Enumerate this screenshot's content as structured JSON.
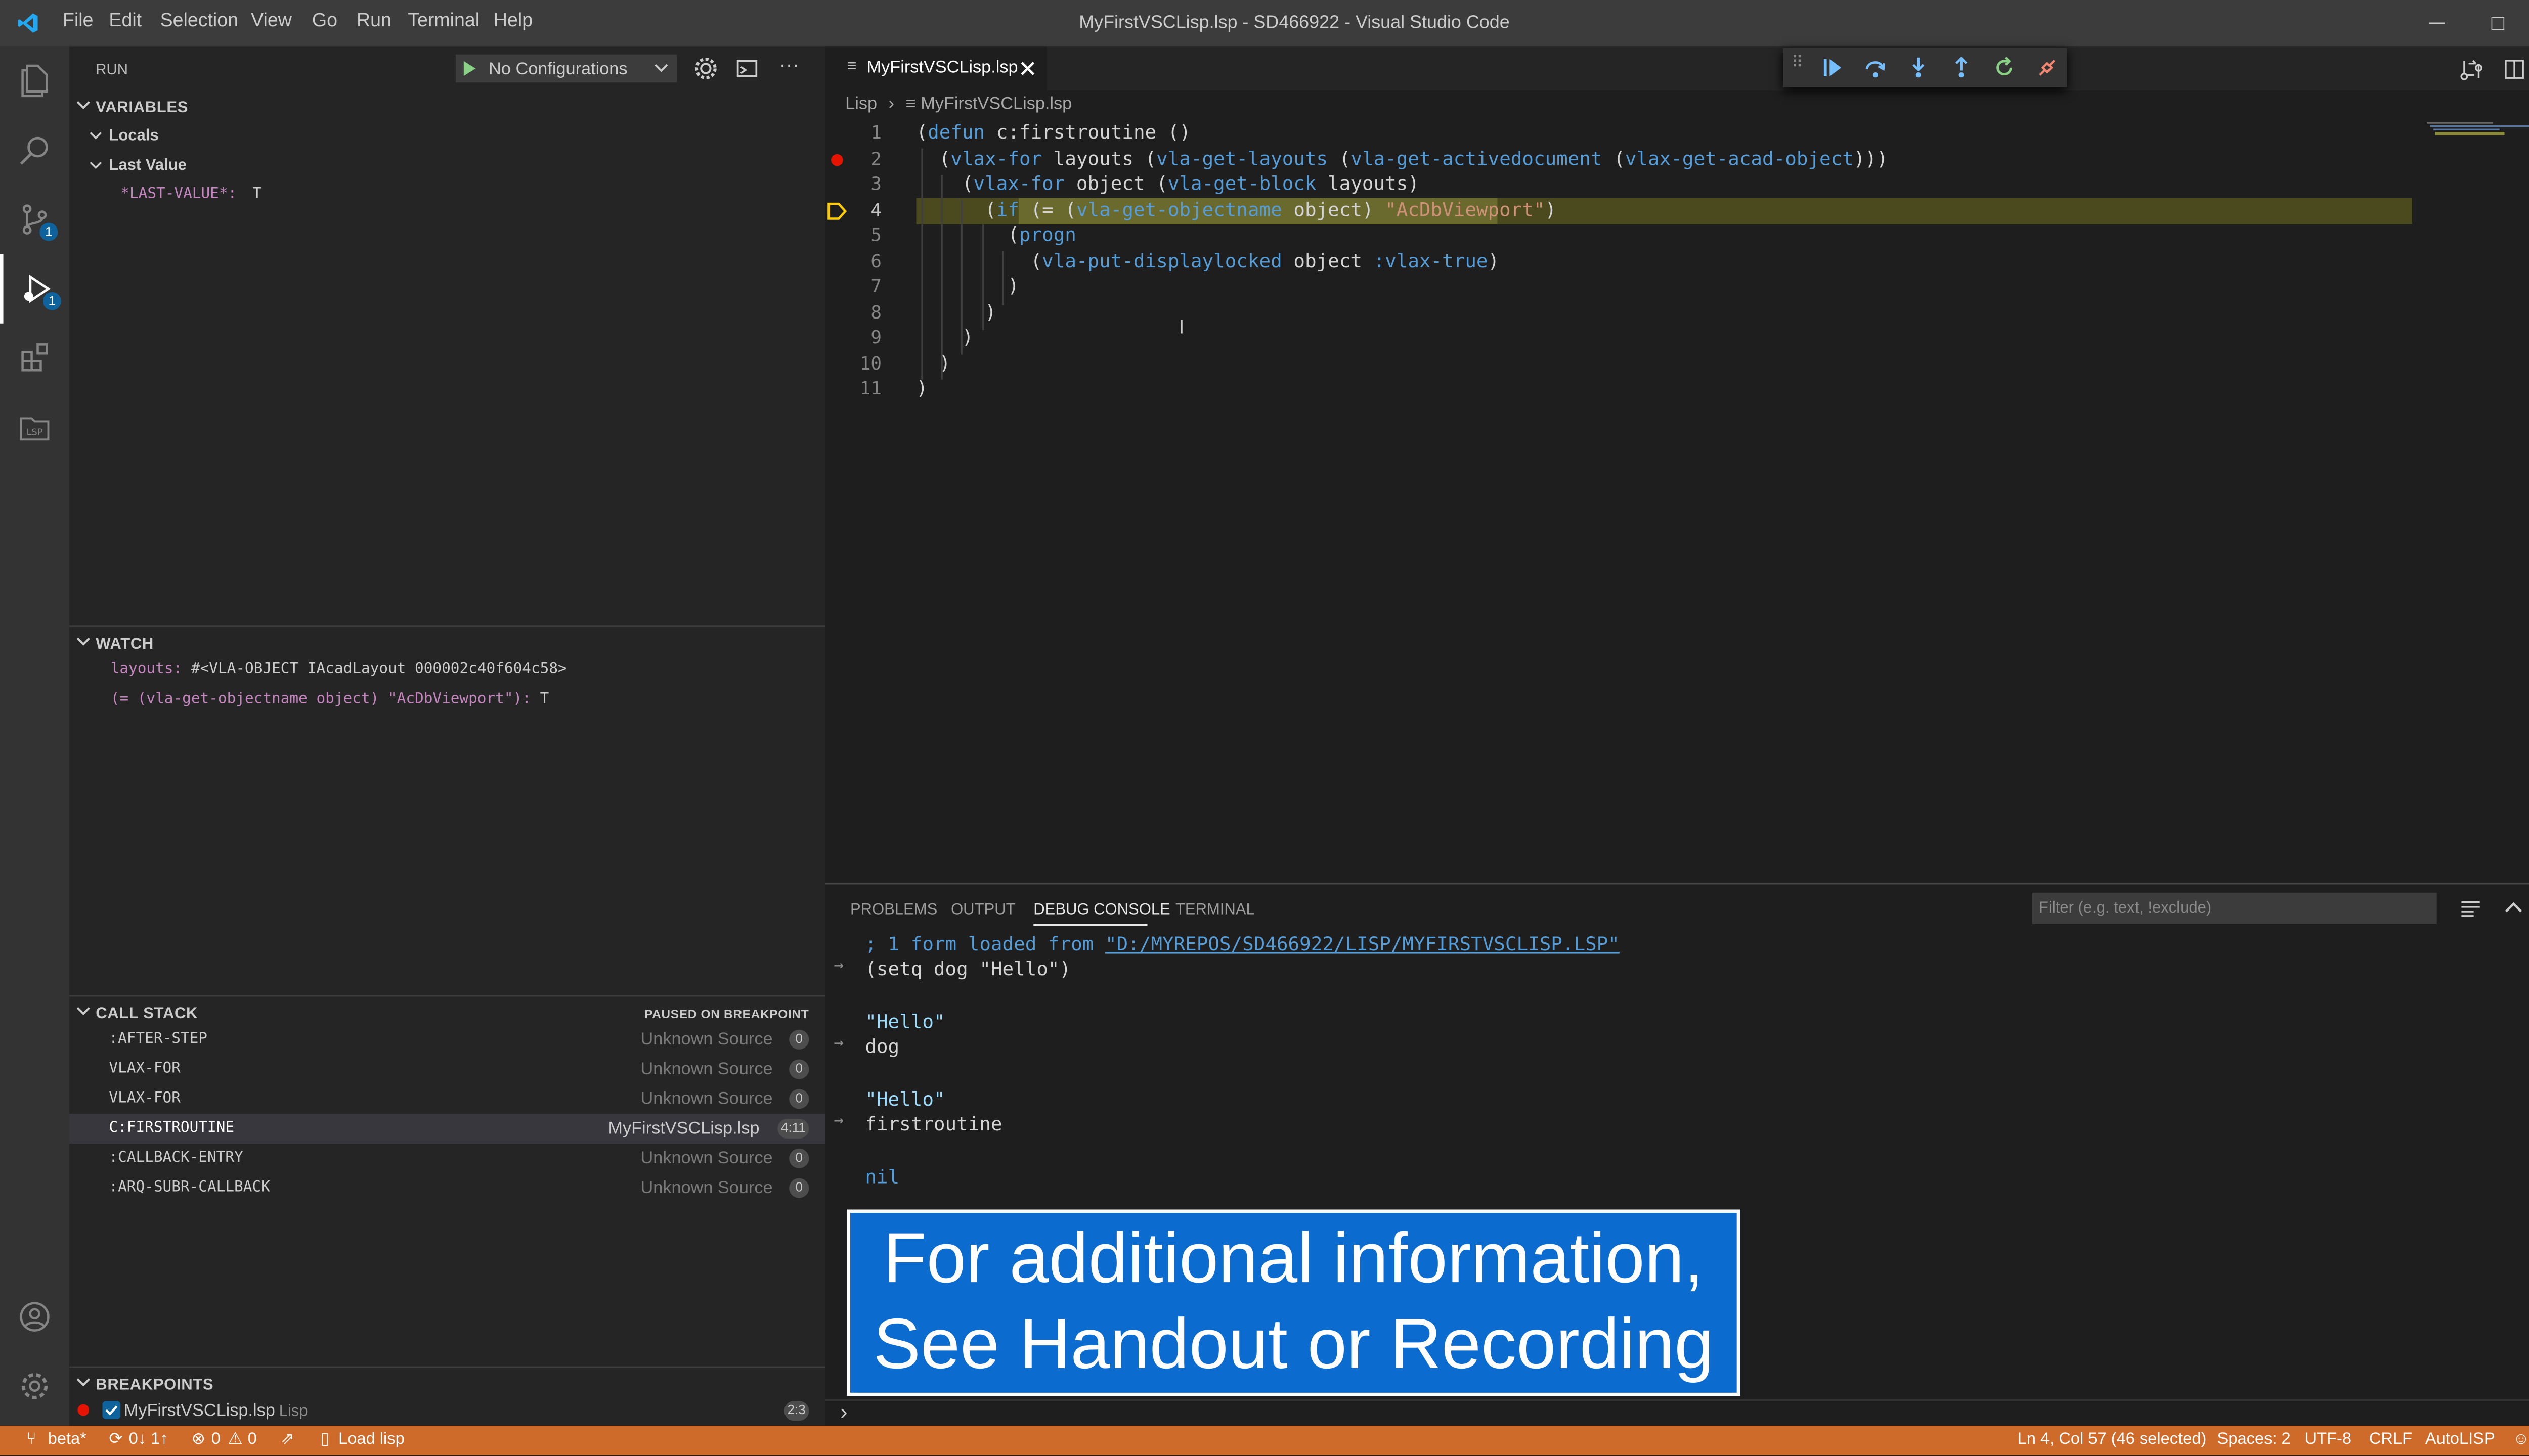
{
  "titlebar": {
    "menu": [
      "File",
      "Edit",
      "Selection",
      "View",
      "Go",
      "Run",
      "Terminal",
      "Help"
    ],
    "title": "MyFirstVSCLisp.lsp - SD466922 - Visual Studio Code",
    "minimize": "─",
    "maximize": "□",
    "close": "✕"
  },
  "activity": {
    "badges": {
      "scm": "1",
      "debug": "1"
    }
  },
  "sidebar": {
    "run_label": "RUN",
    "config_label": "No Configurations",
    "more": "···",
    "variables": {
      "header": "VARIABLES",
      "locals": "Locals",
      "last_value": "Last Value",
      "var_name": "*LAST-VALUE*:",
      "var_value": "T"
    },
    "watch": {
      "header": "WATCH",
      "items": [
        {
          "name": "layouts:",
          "value": "#<VLA-OBJECT IAcadLayout 000002c40f604c58>"
        },
        {
          "name": "(= (vla-get-objectname object) \"AcDbViewport\"):",
          "value": "T"
        }
      ]
    },
    "callstack": {
      "header": "CALL STACK",
      "status": "PAUSED ON BREAKPOINT",
      "frames": [
        {
          "name": ":AFTER-STEP",
          "source": "Unknown Source",
          "line": "0"
        },
        {
          "name": "VLAX-FOR",
          "source": "Unknown Source",
          "line": "0"
        },
        {
          "name": "VLAX-FOR",
          "source": "Unknown Source",
          "line": "0"
        },
        {
          "name": "C:FIRSTROUTINE",
          "source": "MyFirstVSCLisp.lsp",
          "line": "4:11"
        },
        {
          "name": ":CALLBACK-ENTRY",
          "source": "Unknown Source",
          "line": "0"
        },
        {
          "name": ":ARQ-SUBR-CALLBACK",
          "source": "Unknown Source",
          "line": "0"
        }
      ]
    },
    "breakpoints": {
      "header": "BREAKPOINTS",
      "file": "MyFirstVSCLisp.lsp",
      "folder": "Lisp",
      "count": "2:3"
    }
  },
  "editor": {
    "tab_label": "MyFirstVSCLisp.lsp",
    "breadcrumb_folder": "Lisp",
    "breadcrumb_file": "MyFirstVSCLisp.lsp",
    "line_numbers": [
      "1",
      "2",
      "3",
      "4",
      "5",
      "6",
      "7",
      "8",
      "9",
      "10",
      "11"
    ]
  },
  "panel": {
    "tabs": [
      "PROBLEMS",
      "OUTPUT",
      "DEBUG CONSOLE",
      "TERMINAL"
    ],
    "filter_placeholder": "Filter (e.g. text, !exclude)",
    "console": {
      "loaded_prefix": "; 1 form loaded from ",
      "loaded_path": "\"D:/MYREPOS/SD466922/LISP/MYFIRSTVSCLISP.LSP\"",
      "in1": "(setq dog \"Hello\")",
      "out1": "\"Hello\"",
      "in2": "dog",
      "out2": "\"Hello\"",
      "in3": "firstroutine",
      "out3": "nil",
      "prompt": "›"
    }
  },
  "overlay": {
    "line1": "For additional information,",
    "line2": "See Handout or Recording"
  },
  "statusbar": {
    "branch": "beta*",
    "sync": "0↓ 1↑",
    "errors": "0",
    "warnings": "0",
    "load": "Load lisp",
    "position": "Ln 4, Col 57 (46 selected)",
    "spaces": "Spaces: 2",
    "encoding": "UTF-8",
    "eol": "CRLF",
    "language": "AutoLISP"
  },
  "colors": {
    "statusbar": "#ce6a2a",
    "overlay": "#0b6bcf",
    "highlight_line": "#4b4a1e",
    "breakpoint": "#e51400"
  }
}
